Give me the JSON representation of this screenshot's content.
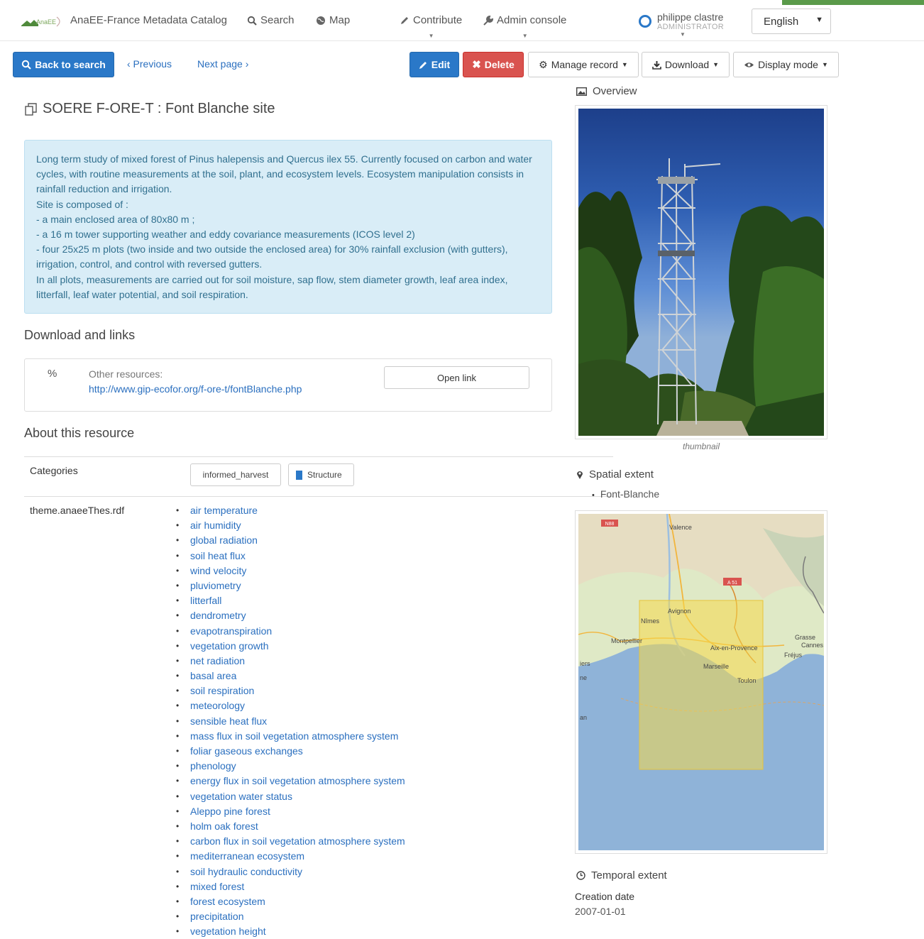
{
  "nav": {
    "brand": "AnaEE-France Metadata Catalog",
    "search": "Search",
    "map": "Map",
    "contribute": "Contribute",
    "admin": "Admin console",
    "user_name": "philippe clastre",
    "user_role": "ADMINISTRATOR",
    "language": "English",
    "logo_text": "AnaEE"
  },
  "toolbar": {
    "back": "Back to search",
    "previous": "‹ Previous",
    "next": "Next page ›",
    "edit": "Edit",
    "delete": "Delete",
    "manage": "Manage record",
    "download": "Download",
    "display": "Display mode"
  },
  "record": {
    "title": "SOERE F-ORE-T : Font Blanche site",
    "abstract": [
      "Long term study of mixed forest of Pinus halepensis and Quercus ilex 55. Currently focused on carbon and water cycles, with routine measurements at the soil, plant, and ecosystem levels. Ecosystem manipulation consists in rainfall reduction and irrigation.",
      "Site is composed of :",
      "- a main enclosed area of 80x80 m ;",
      "- a 16 m tower supporting weather and eddy covariance measurements (ICOS level 2)",
      "- four 25x25 m plots (two inside and two outside the enclosed area) for 30% rainfall exclusion (with gutters), irrigation, control, and control with reversed gutters.",
      "In all plots, measurements are carried out for soil moisture, sap flow, stem diameter growth, leaf area index, litterfall, leaf water potential, and soil respiration."
    ]
  },
  "links": {
    "heading": "Download and links",
    "label": "Other resources:",
    "url": "http://www.gip-ecofor.org/f-ore-t/fontBlanche.php",
    "open": "Open link"
  },
  "about": {
    "heading": "About this resource",
    "categories_label": "Categories",
    "chips": [
      "informed_harvest",
      "Structure"
    ],
    "theme_label": "theme.anaeeThes.rdf",
    "keywords": [
      "air temperature",
      "air humidity",
      "global radiation",
      "soil heat flux",
      "wind velocity",
      "pluviometry",
      "litterfall",
      "dendrometry",
      "evapotranspiration",
      "vegetation growth",
      "net radiation",
      "basal area",
      "soil respiration",
      "meteorology",
      "sensible heat flux",
      "mass flux in soil vegetation atmosphere system",
      "foliar gaseous exchanges",
      "phenology",
      "energy flux in soil vegetation atmosphere system",
      "vegetation water status",
      "Aleppo pine forest",
      "holm oak forest",
      "carbon flux in soil vegetation atmosphere system",
      "mediterranean ecosystem",
      "soil hydraulic conductivity",
      "mixed forest",
      "forest ecosystem",
      "precipitation",
      "vegetation height"
    ]
  },
  "side": {
    "overview": "Overview",
    "caption": "thumbnail",
    "spatial": "Spatial extent",
    "place": "Font-Blanche",
    "temporal": "Temporal extent",
    "creation_label": "Creation date",
    "creation_value": "2007-01-01"
  },
  "map_labels": {
    "valence": "Valence",
    "avignon": "Avignon",
    "nimes": "Nîmes",
    "montpellier": "Montpellier",
    "aix": "Aix-en-Provence",
    "marseille": "Marseille",
    "toulon": "Toulon",
    "grasse": "Grasse",
    "cannes": "Cannes",
    "frejus": "Fréjus",
    "n88": "N88",
    "a51": "A 51",
    "ers": "iers",
    "ne": "ne",
    "an": "an"
  },
  "colors": {
    "primary": "#2a78c8",
    "danger": "#d9534f",
    "info_bg": "#d9edf7",
    "info_text": "#31708f",
    "link": "#2a6fbf",
    "extent": "#f5d94a"
  }
}
